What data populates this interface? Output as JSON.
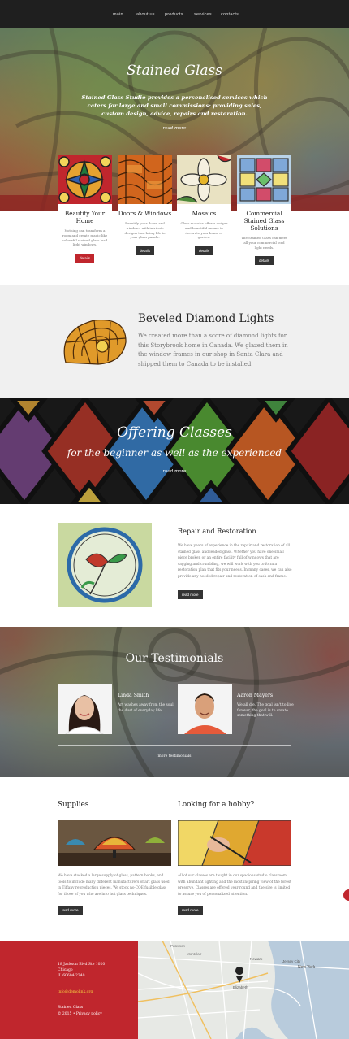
{
  "nav": {
    "items": [
      "main",
      "about us",
      "products",
      "services",
      "contacts"
    ]
  },
  "hero": {
    "title": "Stained Glass",
    "text": "Stained Glass Studio provides a personalised services which caters for large and small commissions: providing sales, custom design, advice, repairs and restoration.",
    "more": "read more"
  },
  "cards": [
    {
      "title": "Beautify Your Home",
      "text": "Nothing can transform a room and create magic like colourful stained glass lead light windows.",
      "button": "details",
      "color": "#c0262d"
    },
    {
      "title": "Doors & Windows",
      "text": "Beautify your doors and windows with intricate designs that bring life to your glass panels.",
      "button": "details",
      "color": "#333333"
    },
    {
      "title": "Mosaics",
      "text": "Glass mosaics offer a unique and beautiful means to decorate your home or garden.",
      "button": "details",
      "color": "#333333"
    },
    {
      "title": "Commercial Stained Glass Solutions",
      "text": "The Stained Glass can meet all your commercial lead light needs.",
      "button": "details",
      "color": "#333333"
    }
  ],
  "beveled": {
    "title": "Beveled Diamond Lights",
    "text": "We created more than a score of diamond lights for this Storybrook home in Canada. We glazed them in the window frames in our shop in Santa Clara and shipped them to Canada to be installed."
  },
  "classes": {
    "title": "Offering Classes",
    "subtitle": "for the beginner as well as the experienced",
    "more": "read more"
  },
  "repair": {
    "title": "Repair and Restoration",
    "text": "We have years of experience in the repair and restoration of all stained glass and leaded glass. Whether you have one small piece broken or an entire facility full of windows that are sagging and crumbling, we will work with you to form a restoration plan that fits your needs. In many cases, we can also provide any needed repair and restoration of sash and frame.",
    "button": "read more"
  },
  "testimonials": {
    "title": "Our Testimonials",
    "items": [
      {
        "name": "Linda Smith",
        "quote": "Art washes away from the soul the dust of everyday life."
      },
      {
        "name": "Aaron Mayers",
        "quote": "We all die. The goal isn't to live forever, the goal is to create something that will."
      }
    ],
    "more": "more testimonials"
  },
  "supplies": {
    "title": "Supplies",
    "text": "We have stocked a large supply of glass, pattern books, and tools to include many different manufacturers of art glass used in Tiffany reproduction pieces. We stock no-COE fusible glass for those of you who are into hot glass techniques.",
    "button": "read more"
  },
  "hobby": {
    "title": "Looking for a hobby?",
    "text": "All of our classes are taught in our spacious studio classroom with abundant lighting and the most inspiring view of the forest preserve. Classes are offered year-round and the size is limited to assure you of personalized attention.",
    "button": "read more"
  },
  "footer": {
    "address1": "18 Jackson Blvd Ste 1020",
    "address2": "Chicago",
    "address3": "IL 60604-2340",
    "email": "info@demolink.org",
    "brand": "Stained Glass",
    "copyright": "© 2015 • Privacy policy"
  },
  "map": {
    "labels": [
      "Newark",
      "Jersey City",
      "New York",
      "Elizabeth",
      "Montclair",
      "Paterson"
    ]
  },
  "colors": {
    "accent": "#c0262d",
    "dark": "#1f1f1f",
    "button": "#333333"
  }
}
